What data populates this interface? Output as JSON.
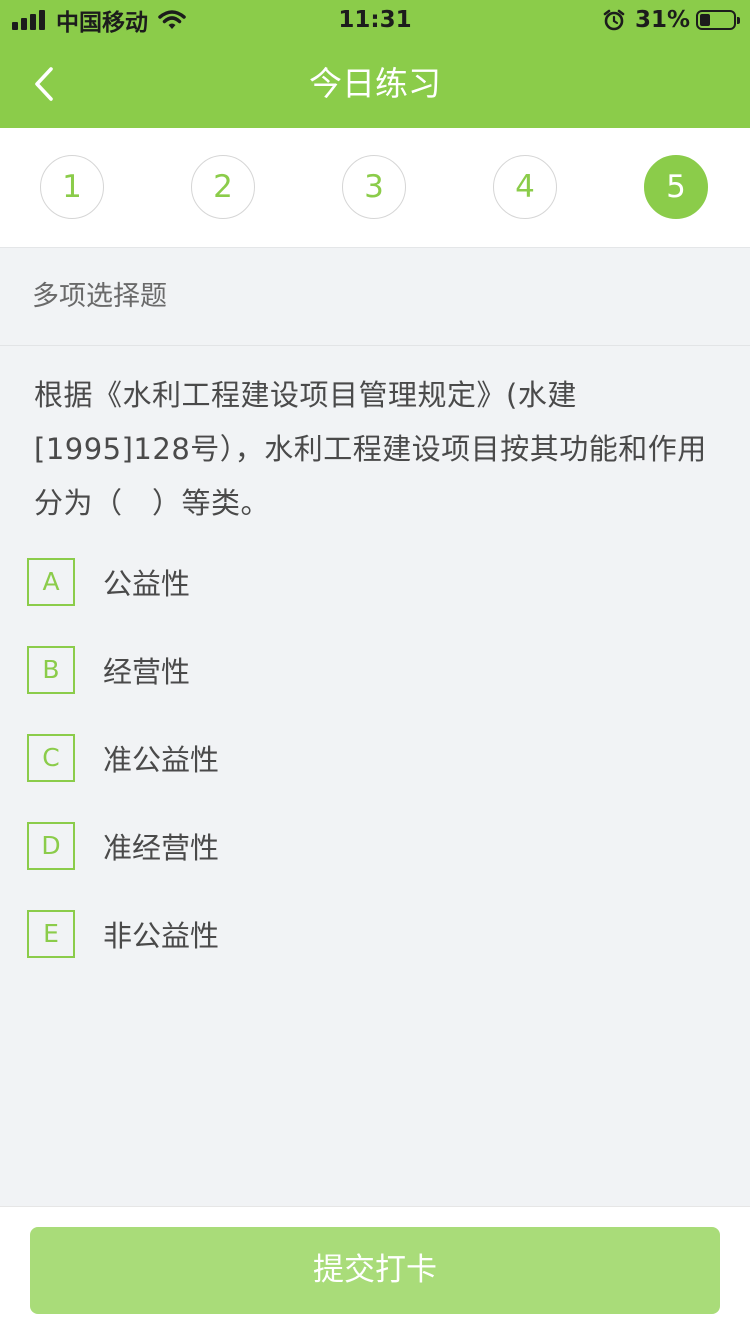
{
  "status_bar": {
    "carrier": "中国移动",
    "time": "11:31",
    "battery_percent": "31%",
    "battery_level": 0.31,
    "icons": [
      "signal-icon",
      "wifi-icon",
      "alarm-icon",
      "battery-icon"
    ]
  },
  "nav": {
    "title": "今日练习",
    "back_icon": "chevron-left-icon"
  },
  "tabs": [
    {
      "label": "1",
      "active": false
    },
    {
      "label": "2",
      "active": false
    },
    {
      "label": "3",
      "active": false
    },
    {
      "label": "4",
      "active": false
    },
    {
      "label": "5",
      "active": true
    }
  ],
  "question": {
    "type": "多项选择题",
    "text": "根据《水利工程建设项目管理规定》(水建[1995]128号），水利工程建设项目按其功能和作用分为（　）等类。",
    "options": [
      {
        "letter": "A",
        "text": "公益性"
      },
      {
        "letter": "B",
        "text": "经营性"
      },
      {
        "letter": "C",
        "text": "准公益性"
      },
      {
        "letter": "D",
        "text": "准经营性"
      },
      {
        "letter": "E",
        "text": "非公益性"
      }
    ]
  },
  "footer": {
    "submit_label": "提交打卡"
  },
  "colors": {
    "brand_green": "#8bcc4a",
    "submit_disabled": "#a9dc79",
    "background": "#f1f3f5"
  }
}
